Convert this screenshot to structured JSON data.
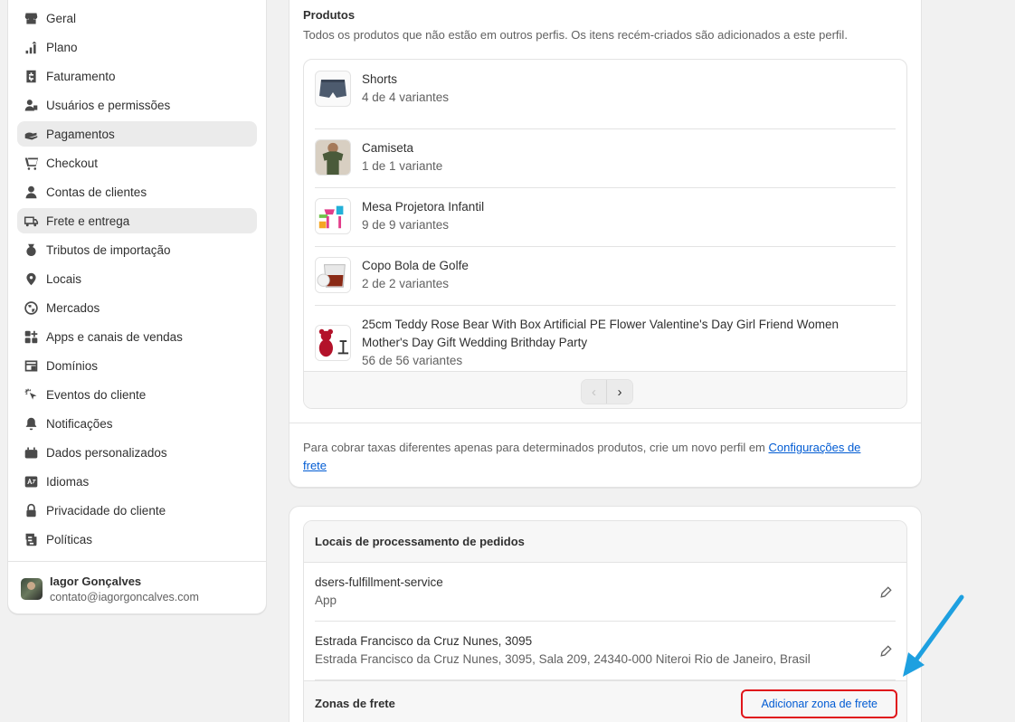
{
  "sidebar": {
    "items": [
      {
        "label": "Geral",
        "icon": "store-icon",
        "active": false
      },
      {
        "label": "Plano",
        "icon": "plan-icon",
        "active": false
      },
      {
        "label": "Faturamento",
        "icon": "billing-icon",
        "active": false
      },
      {
        "label": "Usuários e permissões",
        "icon": "users-icon",
        "active": false
      },
      {
        "label": "Pagamentos",
        "icon": "payments-icon",
        "active": true
      },
      {
        "label": "Checkout",
        "icon": "cart-icon",
        "active": false
      },
      {
        "label": "Contas de clientes",
        "icon": "person-icon",
        "active": false
      },
      {
        "label": "Frete e entrega",
        "icon": "truck-icon",
        "active": true
      },
      {
        "label": "Tributos de importação",
        "icon": "duties-icon",
        "active": false
      },
      {
        "label": "Locais",
        "icon": "location-icon",
        "active": false
      },
      {
        "label": "Mercados",
        "icon": "globe-icon",
        "active": false
      },
      {
        "label": "Apps e canais de vendas",
        "icon": "apps-icon",
        "active": false
      },
      {
        "label": "Domínios",
        "icon": "domain-icon",
        "active": false
      },
      {
        "label": "Eventos do cliente",
        "icon": "cursor-icon",
        "active": false
      },
      {
        "label": "Notificações",
        "icon": "bell-icon",
        "active": false
      },
      {
        "label": "Dados personalizados",
        "icon": "data-icon",
        "active": false
      },
      {
        "label": "Idiomas",
        "icon": "language-icon",
        "active": false
      },
      {
        "label": "Privacidade do cliente",
        "icon": "lock-icon",
        "active": false
      },
      {
        "label": "Políticas",
        "icon": "policy-icon",
        "active": false
      }
    ],
    "user": {
      "name": "Iagor Gonçalves",
      "email": "contato@iagorgoncalves.com"
    }
  },
  "products": {
    "title": "Produtos",
    "description": "Todos os produtos que não estão em outros perfis. Os itens recém-criados são adicionados a este perfil.",
    "items": [
      {
        "name": "Shorts",
        "variants": "4 de 4 variantes",
        "thumb": "shorts"
      },
      {
        "name": "Camiseta",
        "variants": "1 de 1 variante",
        "thumb": "tshirt"
      },
      {
        "name": "Mesa Projetora Infantil",
        "variants": "9 de 9 variantes",
        "thumb": "toy"
      },
      {
        "name": "Copo Bola de Golfe",
        "variants": "2 de 2 variantes",
        "thumb": "glass"
      },
      {
        "name": "25cm Teddy Rose Bear With Box Artificial PE Flower Valentine's Day Girl Friend Women",
        "name_line2": "Mother's Day Gift Wedding Brithday Party",
        "variants": "56 de 56 variantes",
        "thumb": "bear"
      }
    ],
    "pager": {
      "prev": "‹",
      "next": "›"
    },
    "note_text": "Para cobrar taxas diferentes apenas para determinados produtos, crie um novo perfil em ",
    "note_link_1": "Configurações de",
    "note_link_2": "frete"
  },
  "locations": {
    "title": "Locais de processamento de pedidos",
    "items": [
      {
        "name": "dsers-fulfillment-service",
        "sub": "App"
      },
      {
        "name": "Estrada Francisco da Cruz Nunes, 3095",
        "sub": "Estrada Francisco da Cruz Nunes, 3095, Sala 209, 24340-000 Niteroi Rio de Janeiro, Brasil"
      }
    ],
    "zones_title": "Zonas de frete",
    "add_zone_label": "Adicionar zona de frete"
  },
  "colors": {
    "link": "#005bd3",
    "highlight_border": "#e0161b",
    "arrow": "#1ea0e0"
  }
}
